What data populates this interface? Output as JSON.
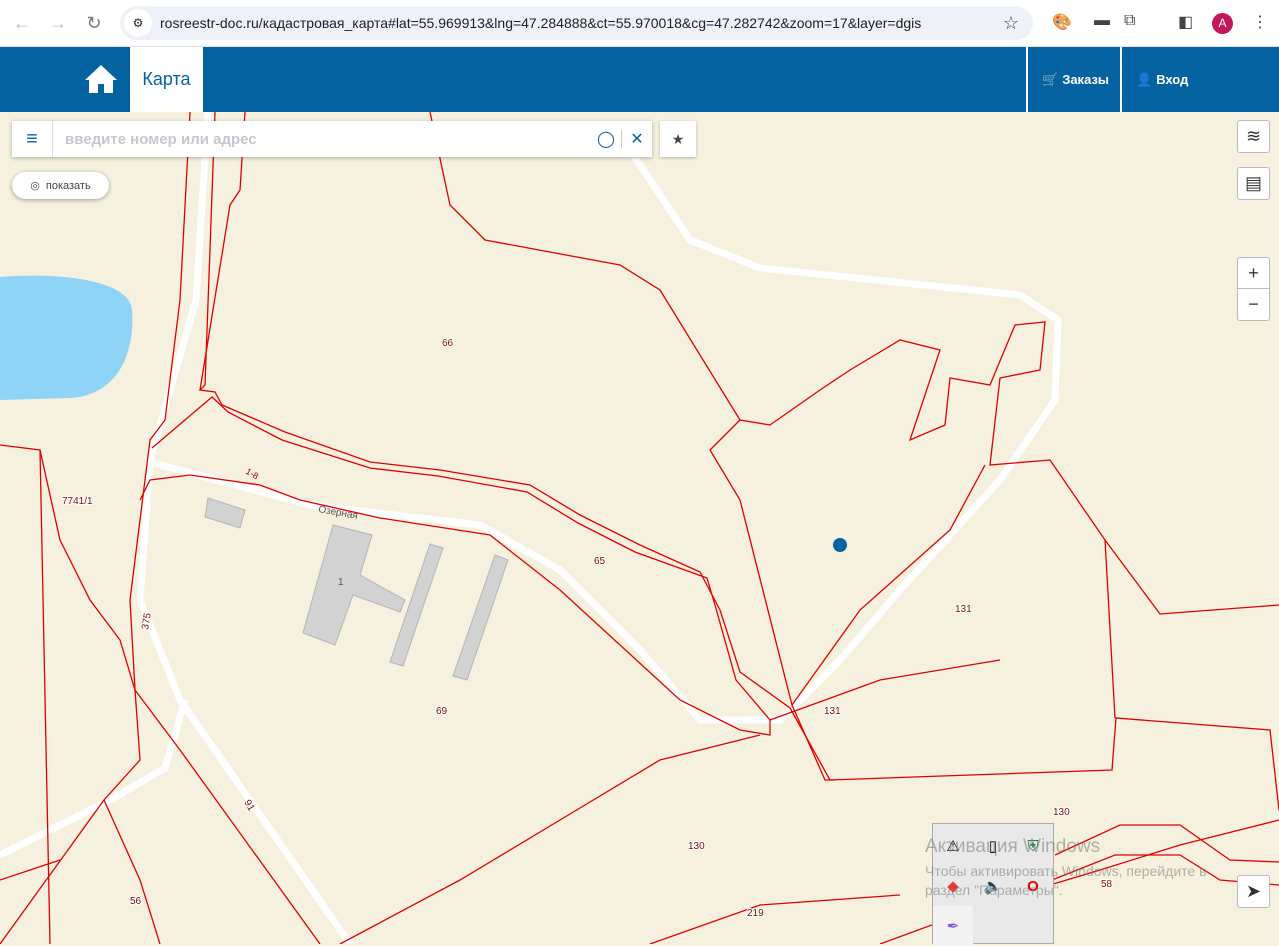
{
  "browser": {
    "url": "rosreestr-doc.ru/кадастровая_карта#lat=55.969913&lng=47.284888&ct=55.970018&cg=47.282742&zoom=17&layer=dgis",
    "avatar": "A"
  },
  "header": {
    "tab": "Карта",
    "orders": "Заказы",
    "login": "Вход"
  },
  "search": {
    "placeholder": "введите номер или адрес",
    "value": ""
  },
  "show_button": "показать",
  "zoom": {
    "in": "+",
    "out": "−"
  },
  "map": {
    "street": "Озерная",
    "building": "1",
    "parcels": [
      "66",
      "7741/1",
      "65",
      "131",
      "131",
      "69",
      "375",
      "91",
      "130",
      "130",
      "56",
      "219",
      "58"
    ],
    "road_mark": "1-8"
  },
  "watermark": {
    "title": "Активация Windows",
    "text": "Чтобы активировать Windows, перейдите в раздел \"Параметры\"."
  },
  "colors": {
    "header": "#0562a1",
    "parcel_border": "#e00000",
    "map_bg": "#f5f1de",
    "water": "#8fd3f7"
  }
}
